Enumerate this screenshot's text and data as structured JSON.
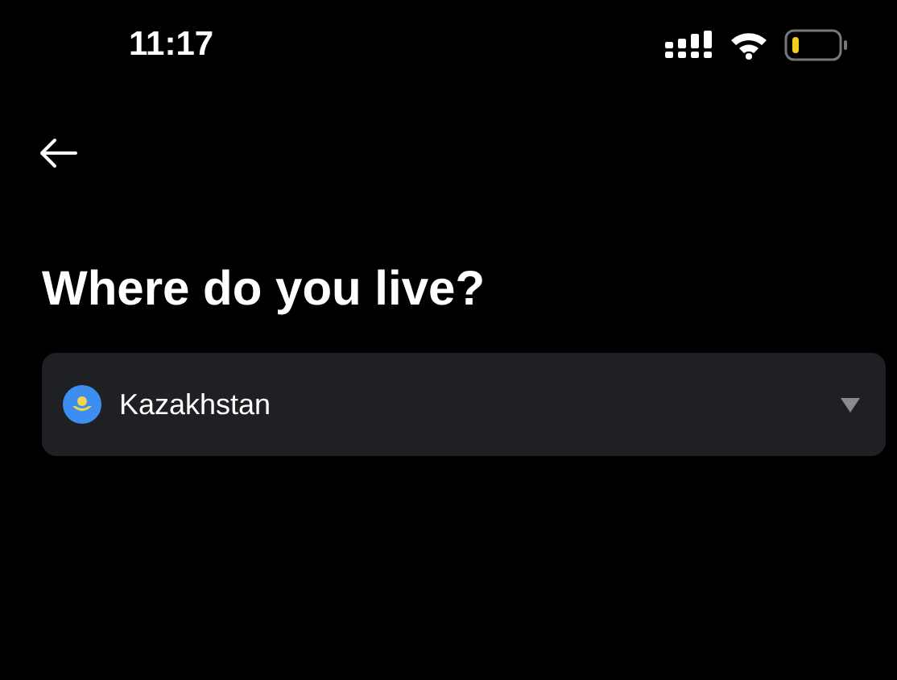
{
  "status_bar": {
    "time": "11:17"
  },
  "title": "Where do you live?",
  "country_select": {
    "value": "Kazakhstan"
  }
}
